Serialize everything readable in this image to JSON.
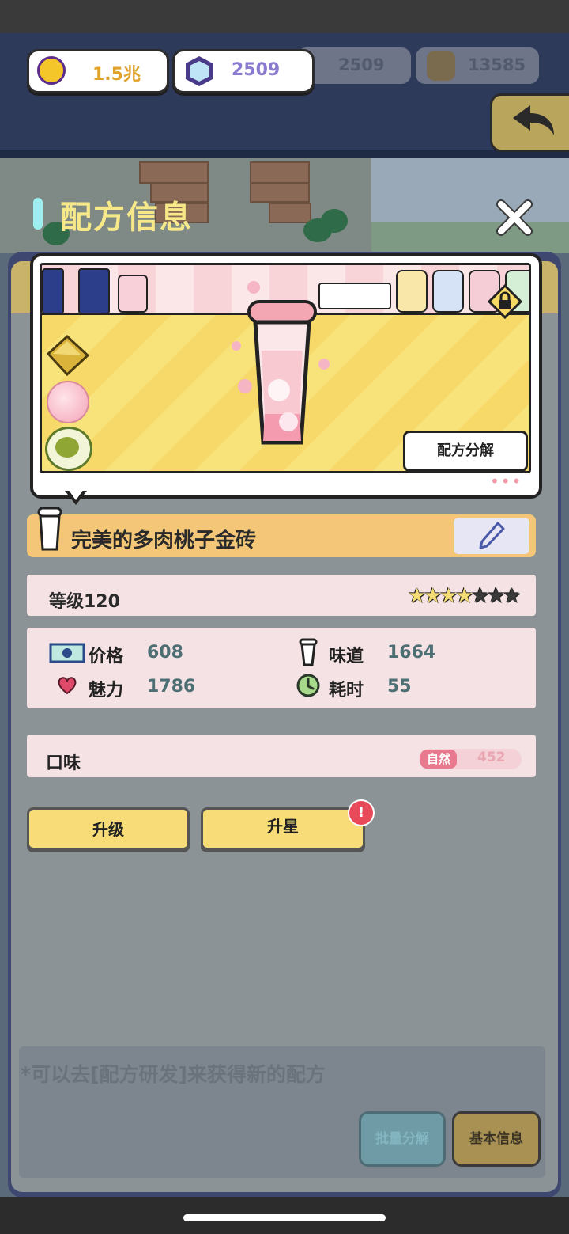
{
  "hud": {
    "coins": "1.5兆",
    "gems": "2509",
    "gems_dim": "2509",
    "bags_dim": "13585"
  },
  "dialog": {
    "title": "配方信息"
  },
  "preview": {
    "decompose_label": "配方分解",
    "more_dots": "•••"
  },
  "recipe": {
    "name": "完美的多肉桃子金砖",
    "level": "等级120",
    "stars_filled": 4,
    "stars_total": 7
  },
  "stats": {
    "price_label": "价格",
    "price_value": "608",
    "taste_label": "味道",
    "taste_value": "1664",
    "charm_label": "魅力",
    "charm_value": "1786",
    "time_label": "耗时",
    "time_value": "55"
  },
  "flavor": {
    "label": "口味",
    "tag": "自然",
    "value": "452"
  },
  "actions": {
    "upgrade": "升级",
    "star_up": "升星",
    "alert": "!"
  },
  "background": {
    "hint": "*可以去[配方研发]来获得新的配方",
    "batch_decompose": "批量分解",
    "basic_info": "基本信息"
  },
  "colors": {
    "title": "#f7e98a",
    "stat_value": "#4d6f74",
    "name_bar": "#f3c777",
    "button": "#f7dc78"
  }
}
